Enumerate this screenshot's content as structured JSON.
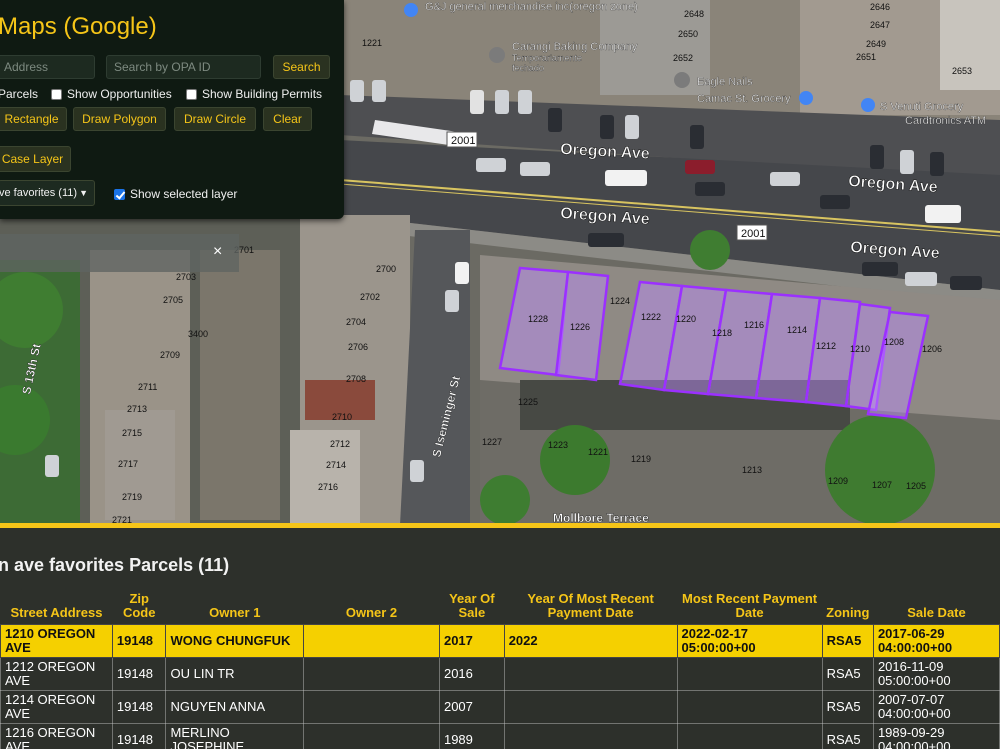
{
  "panel": {
    "title": "Maps (Google)",
    "address_placeholder": "Address",
    "opa_placeholder": "Search by OPA ID",
    "search_label": "Search",
    "checkbox_parcels": "Parcels",
    "checkbox_opportunities": "Show Opportunities",
    "checkbox_permits": "Show Building Permits",
    "btn_rectangle": "Rectangle",
    "btn_polygon": "Draw Polygon",
    "btn_circle": "Draw Circle",
    "btn_clear": "Clear",
    "btn_case_layer": "Case Layer",
    "layer_select": "ve favorites (11)",
    "show_selected_label": "Show selected layer",
    "show_selected_checked": true
  },
  "toast": {
    "close": "×"
  },
  "map": {
    "streets": [
      "Oregon Ave",
      "Oregon Ave",
      "Oregon Ave",
      "Oregon Ave",
      "Mollbore Terrace",
      "S Iseminger St",
      "S 13th St"
    ],
    "pois": [
      "G&J general merchandise inc(oregon zone)",
      "Carangi Baking Company",
      "Temporariamente",
      "fechado",
      "Eagle Nails",
      "Camac St. Grocery",
      "S Venuti Grocery",
      "Cardtronics ATM"
    ],
    "route_badges": [
      "2001",
      "2001"
    ],
    "parcel_numbers": [
      "1228",
      "1226",
      "1224",
      "1222",
      "1220",
      "1218",
      "1216",
      "1214",
      "1212",
      "1210",
      "1208",
      "1206",
      "1225",
      "1227",
      "1223",
      "1221",
      "1219",
      "1213",
      "1209",
      "1207",
      "1205",
      "2701",
      "2703",
      "2705",
      "3400",
      "2709",
      "2711",
      "2713",
      "2715",
      "2717",
      "2719",
      "2721",
      "2700",
      "2702",
      "2704",
      "2706",
      "2708",
      "2710",
      "2712",
      "2714",
      "2716",
      "1221",
      "2648",
      "2650",
      "2652",
      "2647",
      "2649",
      "2651",
      "2653",
      "2646"
    ],
    "terrace_labels": [
      "Mollbore Terrace",
      "Mollbore Terrace",
      "Mollbore Terrace",
      "Mollbore Terrace"
    ]
  },
  "table": {
    "title": "n ave favorites Parcels (11)",
    "headers": [
      "Street Address",
      "Zip Code",
      "Owner 1",
      "Owner 2",
      "Year Of Sale",
      "Year Of Most Recent Payment Date",
      "Most Recent Payment Date",
      "Zoning",
      "Sale Date"
    ],
    "rows": [
      [
        "1210 OREGON AVE",
        "19148",
        "WONG CHUNGFUK",
        "",
        "2017",
        "2022",
        "2022-02-17 05:00:00+00",
        "RSA5",
        "2017-06-29 04:00:00+00"
      ],
      [
        "1212 OREGON AVE",
        "19148",
        "OU LIN TR",
        "",
        "2016",
        "",
        "",
        "RSA5",
        "2016-11-09 05:00:00+00"
      ],
      [
        "1214 OREGON AVE",
        "19148",
        "NGUYEN ANNA",
        "",
        "2007",
        "",
        "",
        "RSA5",
        "2007-07-07 04:00:00+00"
      ],
      [
        "1216 OREGON AVE",
        "19148",
        "MERLINO JOSEPHINE",
        "",
        "1989",
        "",
        "",
        "RSA5",
        "1989-09-29 04:00:00+00"
      ]
    ]
  },
  "colors": {
    "accent": "#f5c518",
    "highlight_row": "#f5d000",
    "parcel_outline": "#9b30ff"
  }
}
